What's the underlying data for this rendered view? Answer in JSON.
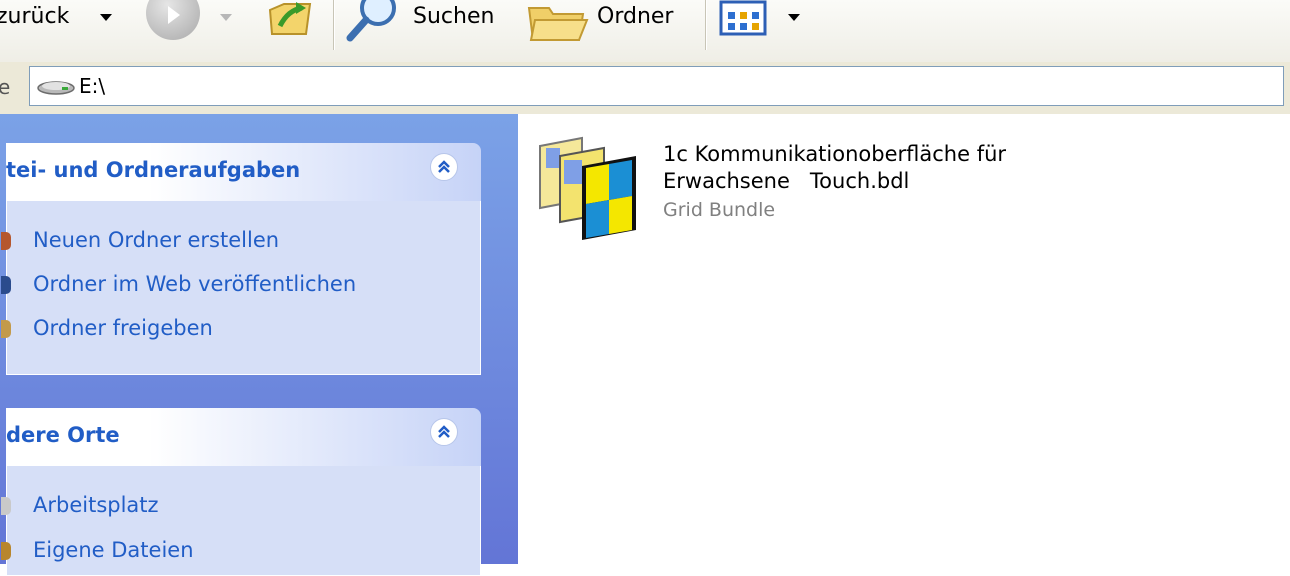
{
  "toolbar": {
    "back_label": "zurück",
    "search_label": "Suchen",
    "folders_label": "Ordner",
    "icons": [
      "back-icon",
      "forward-icon",
      "up-folder-icon",
      "search-icon",
      "folders-icon",
      "views-icon"
    ]
  },
  "address": {
    "caption": "e",
    "value": "E:\\"
  },
  "taskpane": {
    "file_tasks": {
      "title": "tei- und Ordneraufgaben",
      "collapse_glyph": "≈",
      "items": [
        {
          "label": "Neuen Ordner erstellen",
          "icon": "new-folder-icon"
        },
        {
          "label": "Ordner im Web veröffentlichen",
          "icon": "web-publish-icon"
        },
        {
          "label": "Ordner freigeben",
          "icon": "share-icon"
        }
      ]
    },
    "other_places": {
      "title": "dere Orte",
      "collapse_glyph": "≈",
      "items": [
        {
          "label": "Arbeitsplatz",
          "icon": "my-computer-icon"
        },
        {
          "label": "Eigene Dateien",
          "icon": "my-documents-icon"
        }
      ]
    }
  },
  "files": [
    {
      "name_line1": "1c Kommunikationoberfläche für",
      "name_line2": "Erwachsene   Touch.bdl",
      "type": "Grid Bundle",
      "icon": "grid-bundle-icon"
    }
  ],
  "colors": {
    "taskpane_bg": "#7ba2e7",
    "link": "#215dc6",
    "panel_body": "#d6dff7"
  }
}
